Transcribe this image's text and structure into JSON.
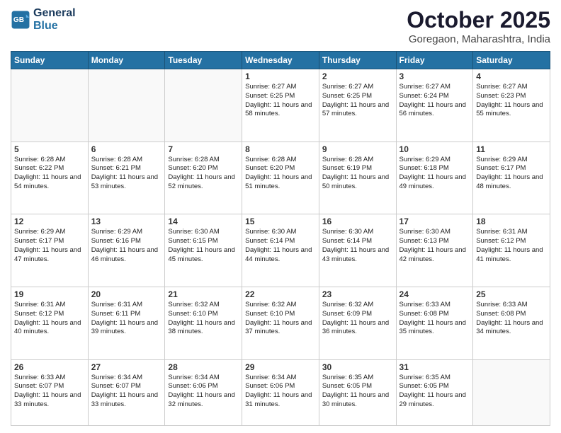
{
  "logo": {
    "line1": "General",
    "line2": "Blue"
  },
  "header": {
    "month": "October 2025",
    "location": "Goregaon, Maharashtra, India"
  },
  "weekdays": [
    "Sunday",
    "Monday",
    "Tuesday",
    "Wednesday",
    "Thursday",
    "Friday",
    "Saturday"
  ],
  "weeks": [
    [
      {
        "day": "",
        "text": ""
      },
      {
        "day": "",
        "text": ""
      },
      {
        "day": "",
        "text": ""
      },
      {
        "day": "1",
        "text": "Sunrise: 6:27 AM\nSunset: 6:25 PM\nDaylight: 11 hours\nand 58 minutes."
      },
      {
        "day": "2",
        "text": "Sunrise: 6:27 AM\nSunset: 6:25 PM\nDaylight: 11 hours\nand 57 minutes."
      },
      {
        "day": "3",
        "text": "Sunrise: 6:27 AM\nSunset: 6:24 PM\nDaylight: 11 hours\nand 56 minutes."
      },
      {
        "day": "4",
        "text": "Sunrise: 6:27 AM\nSunset: 6:23 PM\nDaylight: 11 hours\nand 55 minutes."
      }
    ],
    [
      {
        "day": "5",
        "text": "Sunrise: 6:28 AM\nSunset: 6:22 PM\nDaylight: 11 hours\nand 54 minutes."
      },
      {
        "day": "6",
        "text": "Sunrise: 6:28 AM\nSunset: 6:21 PM\nDaylight: 11 hours\nand 53 minutes."
      },
      {
        "day": "7",
        "text": "Sunrise: 6:28 AM\nSunset: 6:20 PM\nDaylight: 11 hours\nand 52 minutes."
      },
      {
        "day": "8",
        "text": "Sunrise: 6:28 AM\nSunset: 6:20 PM\nDaylight: 11 hours\nand 51 minutes."
      },
      {
        "day": "9",
        "text": "Sunrise: 6:28 AM\nSunset: 6:19 PM\nDaylight: 11 hours\nand 50 minutes."
      },
      {
        "day": "10",
        "text": "Sunrise: 6:29 AM\nSunset: 6:18 PM\nDaylight: 11 hours\nand 49 minutes."
      },
      {
        "day": "11",
        "text": "Sunrise: 6:29 AM\nSunset: 6:17 PM\nDaylight: 11 hours\nand 48 minutes."
      }
    ],
    [
      {
        "day": "12",
        "text": "Sunrise: 6:29 AM\nSunset: 6:17 PM\nDaylight: 11 hours\nand 47 minutes."
      },
      {
        "day": "13",
        "text": "Sunrise: 6:29 AM\nSunset: 6:16 PM\nDaylight: 11 hours\nand 46 minutes."
      },
      {
        "day": "14",
        "text": "Sunrise: 6:30 AM\nSunset: 6:15 PM\nDaylight: 11 hours\nand 45 minutes."
      },
      {
        "day": "15",
        "text": "Sunrise: 6:30 AM\nSunset: 6:14 PM\nDaylight: 11 hours\nand 44 minutes."
      },
      {
        "day": "16",
        "text": "Sunrise: 6:30 AM\nSunset: 6:14 PM\nDaylight: 11 hours\nand 43 minutes."
      },
      {
        "day": "17",
        "text": "Sunrise: 6:30 AM\nSunset: 6:13 PM\nDaylight: 11 hours\nand 42 minutes."
      },
      {
        "day": "18",
        "text": "Sunrise: 6:31 AM\nSunset: 6:12 PM\nDaylight: 11 hours\nand 41 minutes."
      }
    ],
    [
      {
        "day": "19",
        "text": "Sunrise: 6:31 AM\nSunset: 6:12 PM\nDaylight: 11 hours\nand 40 minutes."
      },
      {
        "day": "20",
        "text": "Sunrise: 6:31 AM\nSunset: 6:11 PM\nDaylight: 11 hours\nand 39 minutes."
      },
      {
        "day": "21",
        "text": "Sunrise: 6:32 AM\nSunset: 6:10 PM\nDaylight: 11 hours\nand 38 minutes."
      },
      {
        "day": "22",
        "text": "Sunrise: 6:32 AM\nSunset: 6:10 PM\nDaylight: 11 hours\nand 37 minutes."
      },
      {
        "day": "23",
        "text": "Sunrise: 6:32 AM\nSunset: 6:09 PM\nDaylight: 11 hours\nand 36 minutes."
      },
      {
        "day": "24",
        "text": "Sunrise: 6:33 AM\nSunset: 6:08 PM\nDaylight: 11 hours\nand 35 minutes."
      },
      {
        "day": "25",
        "text": "Sunrise: 6:33 AM\nSunset: 6:08 PM\nDaylight: 11 hours\nand 34 minutes."
      }
    ],
    [
      {
        "day": "26",
        "text": "Sunrise: 6:33 AM\nSunset: 6:07 PM\nDaylight: 11 hours\nand 33 minutes."
      },
      {
        "day": "27",
        "text": "Sunrise: 6:34 AM\nSunset: 6:07 PM\nDaylight: 11 hours\nand 33 minutes."
      },
      {
        "day": "28",
        "text": "Sunrise: 6:34 AM\nSunset: 6:06 PM\nDaylight: 11 hours\nand 32 minutes."
      },
      {
        "day": "29",
        "text": "Sunrise: 6:34 AM\nSunset: 6:06 PM\nDaylight: 11 hours\nand 31 minutes."
      },
      {
        "day": "30",
        "text": "Sunrise: 6:35 AM\nSunset: 6:05 PM\nDaylight: 11 hours\nand 30 minutes."
      },
      {
        "day": "31",
        "text": "Sunrise: 6:35 AM\nSunset: 6:05 PM\nDaylight: 11 hours\nand 29 minutes."
      },
      {
        "day": "",
        "text": ""
      }
    ]
  ]
}
